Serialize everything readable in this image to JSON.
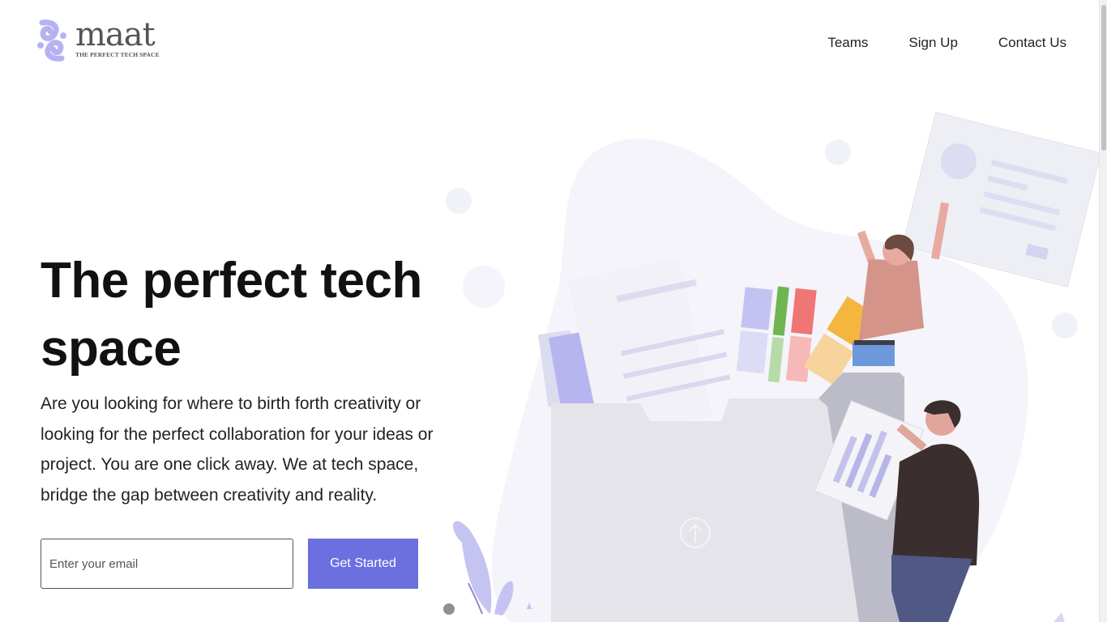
{
  "brand": {
    "name": "maat",
    "tagline": "THE PERFECT TECH SPACE",
    "logo_icon": "swirl-logo-icon",
    "logo_color": "#b6b2f2"
  },
  "nav": {
    "items": [
      {
        "label": "Teams"
      },
      {
        "label": "Sign Up"
      },
      {
        "label": "Contact Us"
      }
    ]
  },
  "hero": {
    "title": "The perfect tech space",
    "description": "Are you looking for where to birth forth creativity or looking for the perfect collaboration for your ideas or project. You are one click away. We at tech space, bridge the gap between creativity and reality.",
    "email_placeholder": "Enter your email",
    "cta_label": "Get Started"
  },
  "illustration": {
    "name": "people-collaborating-illustration",
    "upload_icon": "upload-arrow-icon"
  },
  "colors": {
    "accent": "#6c6fe0",
    "blob": "#f4f4fa",
    "text": "#111111"
  }
}
